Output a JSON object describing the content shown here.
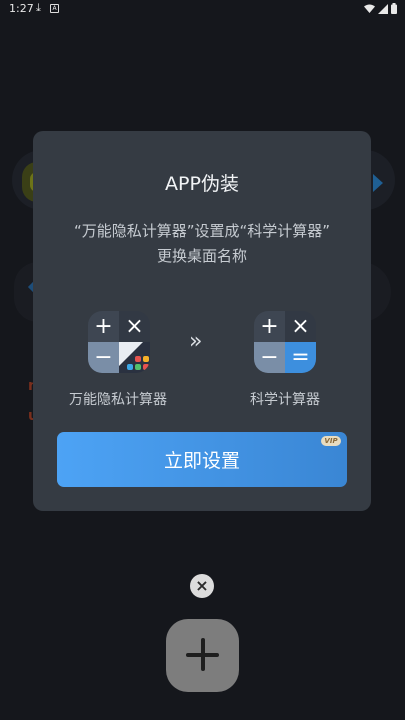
{
  "status_bar": {
    "time": "1:27",
    "download_icon": "download-icon",
    "app_icon": "a-icon"
  },
  "dialog": {
    "title": "APP伪装",
    "description_line1": "“万能隐私计算器”设置成“科学计算器”",
    "description_line2": "更换桌面名称",
    "from_icon": {
      "label": "万能隐私计算器",
      "glyphs": [
        "+",
        "×",
        "−"
      ]
    },
    "to_icon": {
      "label": "科学计算器",
      "glyphs": [
        "+",
        "×",
        "−",
        "="
      ]
    },
    "arrow": "»",
    "button_label": "立即设置",
    "vip_badge": "VIP"
  },
  "close_icon": "×",
  "background": {
    "char1": "n",
    "char2": "u"
  },
  "colors": {
    "button_start": "#4da3f5",
    "button_end": "#3a86d4",
    "dialog_bg": "#353b43"
  }
}
